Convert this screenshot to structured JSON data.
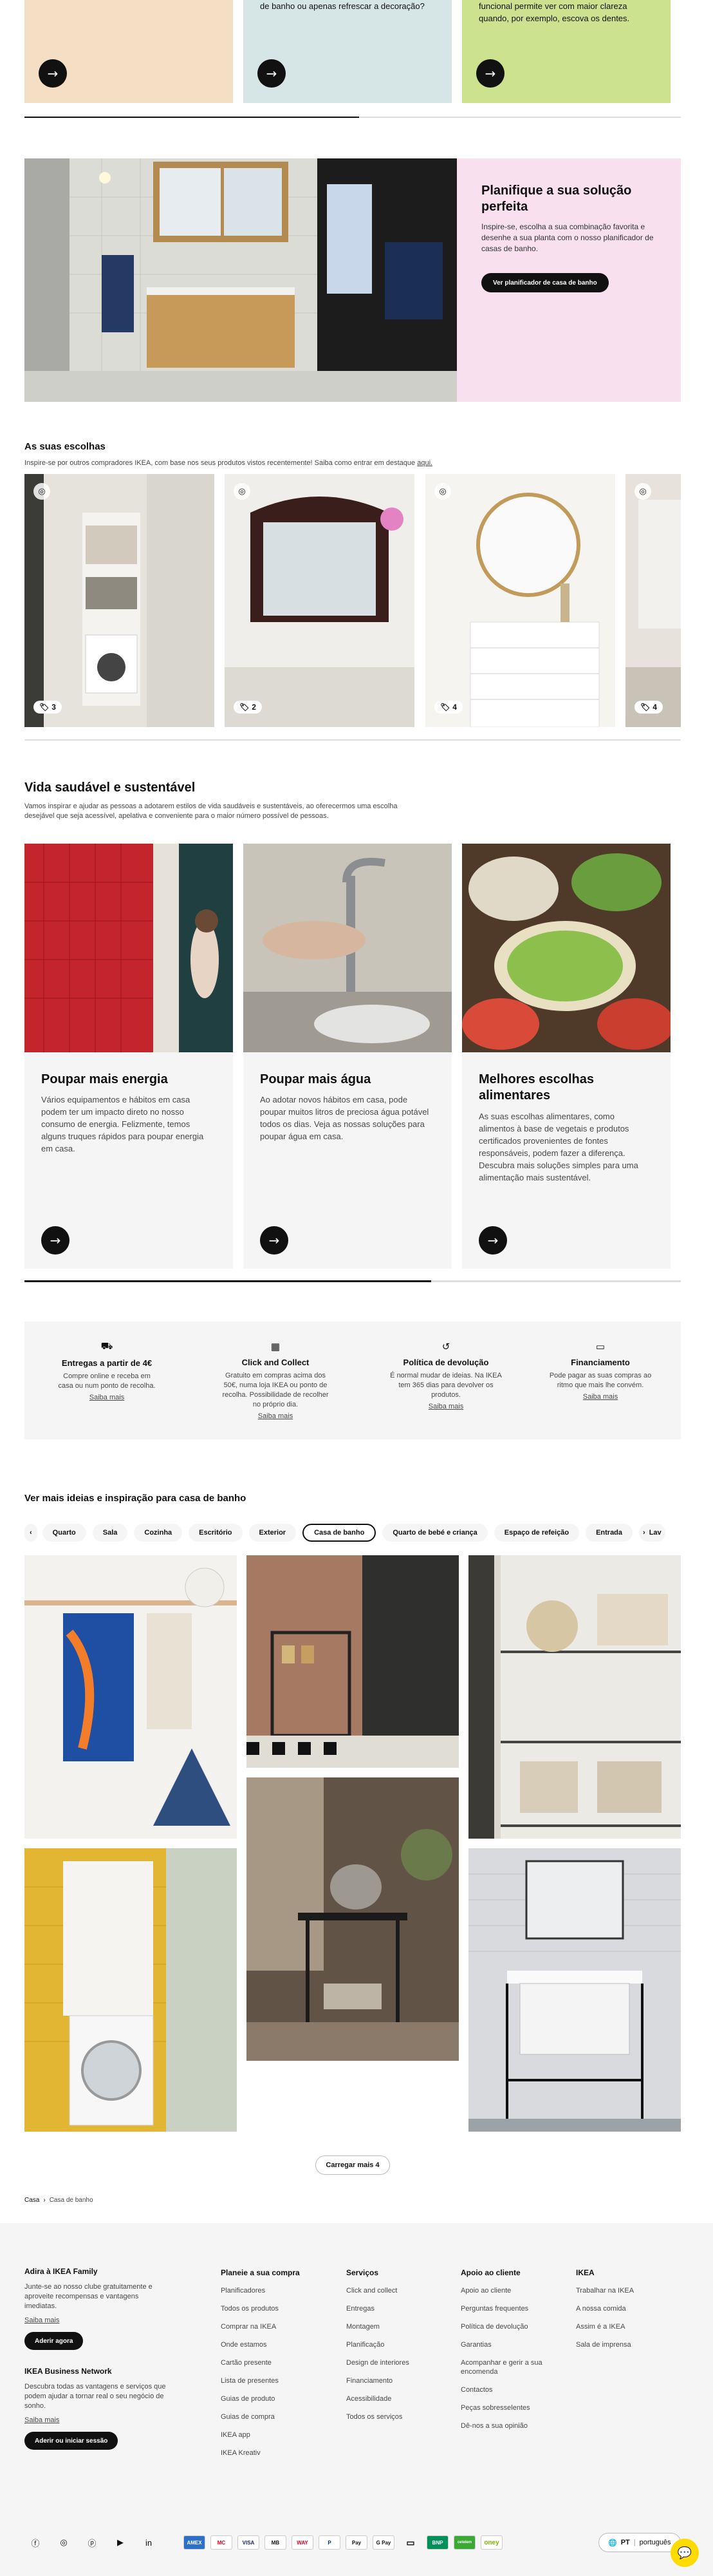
{
  "top_cards": [
    {
      "text": "",
      "bg": "#f5dfc4"
    },
    {
      "text": "de banho ou apenas refrescar a decoração?",
      "bg": "#d6e5e6"
    },
    {
      "text": "funcional permite ver com maior clareza quando, por exemplo, escova os dentes.",
      "bg": "#cde28f"
    }
  ],
  "planner": {
    "title": "Planifique a sua solução perfeita",
    "text": "Inspire-se, escolha a sua combinação favorita e desenhe a sua planta com o nosso planificador de casas de banho.",
    "button": "Ver planificador de casa de banho",
    "bg": "#f8e0ef"
  },
  "choices": {
    "title": "As suas escolhas",
    "text": "Inspire-se por outros compradores IKEA, com base nos seus produtos vistos recentemente! Saiba como entrar em destaque",
    "link": "aqui.",
    "tags": [
      "3",
      "2",
      "4",
      "4"
    ]
  },
  "healthy": {
    "title": "Vida saudável e sustentável",
    "text": "Vamos inspirar e ajudar as pessoas a adotarem estilos de vida saudáveis e sustentáveis, ao oferecermos uma escolha desejável que seja acessível, apelativa e conveniente para o maior número possível de pessoas.",
    "cards": [
      {
        "title": "Poupar mais energia",
        "text": "Vários equipamentos e hábitos em casa podem ter um impacto direto no nosso consumo de energia. Felizmente, temos alguns truques rápidos para poupar energia em casa."
      },
      {
        "title": "Poupar mais água",
        "text": "Ao adotar novos hábitos em casa, pode poupar muitos litros de preciosa água potável todos os dias. Veja as nossas soluções para poupar água em casa."
      },
      {
        "title": "Melhores escolhas alimentares",
        "text": "As suas escolhas alimentares, como alimentos à base de vegetais e produtos certificados provenientes de fontes responsáveis, podem fazer a diferença. Descubra mais soluções simples para uma alimentação mais sustentável."
      }
    ]
  },
  "services": [
    {
      "icon": "truck-icon",
      "title": "Entregas a partir de 4€",
      "text": "Compre online e receba em casa ou num ponto de recolha.",
      "link": "Saiba mais"
    },
    {
      "icon": "store-icon",
      "title": "Click and Collect",
      "text": "Gratuito em compras acima dos 50€, numa loja IKEA ou ponto de recolha. Possibilidade de recolher no próprio dia.",
      "link": "Saiba mais"
    },
    {
      "icon": "return-icon",
      "title": "Política de devolução",
      "text": "É normal mudar de ideias. Na IKEA tem 365 dias para devolver os produtos.",
      "link": "Saiba mais"
    },
    {
      "icon": "card-icon",
      "title": "Financiamento",
      "text": "Pode pagar as suas compras ao ritmo que mais lhe convém.",
      "link": "Saiba mais"
    }
  ],
  "ideas": {
    "title": "Ver mais ideias e inspiração para casa de banho",
    "pills": [
      "Quarto",
      "Sala",
      "Cozinha",
      "Escritório",
      "Exterior",
      "Casa de banho",
      "Quarto de bebé e criança",
      "Espaço de refeição",
      "Entrada",
      "Lav"
    ],
    "active": "Casa de banho",
    "load_more": "Carregar mais 4"
  },
  "breadcrumb": [
    "Casa",
    "Casa de banho"
  ],
  "footer": {
    "family": {
      "title": "Adira à IKEA Family",
      "text": "Junte-se ao nosso clube gratuitamente e aproveite recompensas e vantagens imediatas.",
      "link": "Saiba mais",
      "button": "Aderir agora"
    },
    "business": {
      "title": "IKEA Business Network",
      "text": "Descubra todas as vantagens e serviços que podem ajudar a tornar real o seu negócio de sonho.",
      "link": "Saiba mais",
      "button": "Aderir ou iniciar sessão"
    },
    "columns": [
      {
        "title": "Planeie a sua compra",
        "items": [
          "Planificadores",
          "Todos os produtos",
          "Comprar na IKEA",
          "Onde estamos",
          "Cartão presente",
          "Lista de presentes",
          "Guias de produto",
          "Guias de compra",
          "IKEA app",
          "IKEA Kreativ"
        ]
      },
      {
        "title": "Serviços",
        "items": [
          "Click and collect",
          "Entregas",
          "Montagem",
          "Planificação",
          "Design de interiores",
          "Financiamento",
          "Acessibilidade",
          "Todos os serviços"
        ]
      },
      {
        "title": "Apoio ao cliente",
        "items": [
          "Apoio ao cliente",
          "Perguntas frequentes",
          "Política de devolução",
          "Garantias",
          "Acompanhar e gerir a sua encomenda",
          "Contactos",
          "Peças sobresselentes",
          "Dê-nos a sua opinião"
        ]
      },
      {
        "title": "IKEA",
        "items": [
          "Trabalhar na IKEA",
          "A nossa comida",
          "Assim é a IKEA",
          "Sala de imprensa"
        ]
      }
    ],
    "payments": [
      "AMEX",
      "MC",
      "VISA",
      "MB",
      "WAY",
      "P",
      "Pay",
      "G Pay",
      "▭",
      "BNP",
      "cetelem",
      "oney"
    ],
    "lang_code": "PT",
    "lang": "português"
  }
}
